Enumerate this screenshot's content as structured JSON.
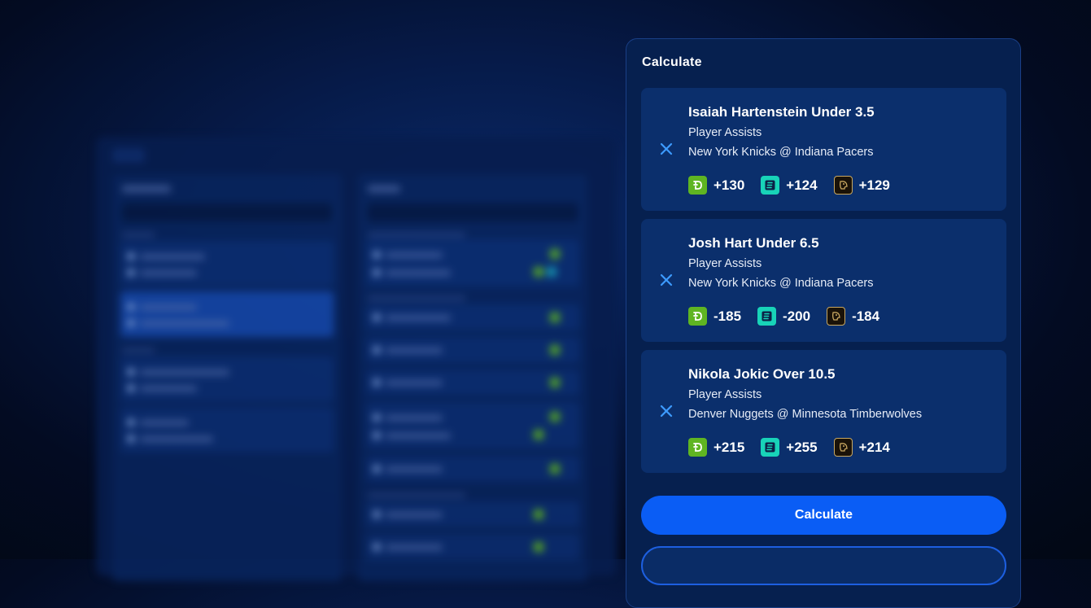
{
  "panel": {
    "title": "Calculate",
    "calculate_label": "Calculate"
  },
  "bets": [
    {
      "title": "Isaiah Hartenstein Under 3.5",
      "market": "Player Assists",
      "game": "New York Knicks @ Indiana Pacers",
      "odds": {
        "draftkings": "+130",
        "espnbet": "+124",
        "betmgm": "+129"
      }
    },
    {
      "title": "Josh Hart Under 6.5",
      "market": "Player Assists",
      "game": "New York Knicks @ Indiana Pacers",
      "odds": {
        "draftkings": "-185",
        "espnbet": "-200",
        "betmgm": "-184"
      }
    },
    {
      "title": "Nikola Jokic Over 10.5",
      "market": "Player Assists",
      "game": "Denver Nuggets @ Minnesota Timberwolves",
      "odds": {
        "draftkings": "+215",
        "espnbet": "+255",
        "betmgm": "+214"
      }
    }
  ],
  "icons": {
    "remove": "close-icon",
    "draftkings": "draftkings-logo-icon",
    "espnbet": "espn-bet-logo-icon",
    "betmgm": "betmgm-logo-icon"
  },
  "colors": {
    "accent": "#0a5df5",
    "panel_bg": "#06204f",
    "card_bg": "#0b2f6c",
    "remove_icon": "#3d9bff",
    "draftkings": "#5fb522",
    "espnbet": "#18d3b8",
    "betmgm": "#c9a862"
  }
}
